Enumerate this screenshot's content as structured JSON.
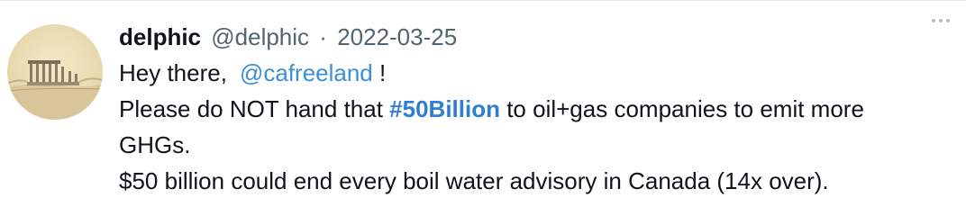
{
  "tweet": {
    "display_name": "delphic",
    "handle": "@delphic",
    "separator": "·",
    "date": "2022-03-25",
    "more_icon": "more-horizontal-icon",
    "avatar_icon": "greek-temple-ruins-avatar",
    "body": {
      "line1_prefix": "Hey there,",
      "line1_mention": "@cafreeland",
      "line1_suffix": " !",
      "line2_prefix": "Please do NOT hand that ",
      "line2_hashtag": "#50Billion",
      "line2_suffix": " to oil+gas companies to emit more",
      "line3": "GHGs.",
      "line4": "$50 billion could end every boil water advisory in Canada (14x over)."
    }
  },
  "colors": {
    "text": "#0f1419",
    "muted": "#536471",
    "link": "#2f7fd0",
    "divider": "#e6e9ec"
  }
}
